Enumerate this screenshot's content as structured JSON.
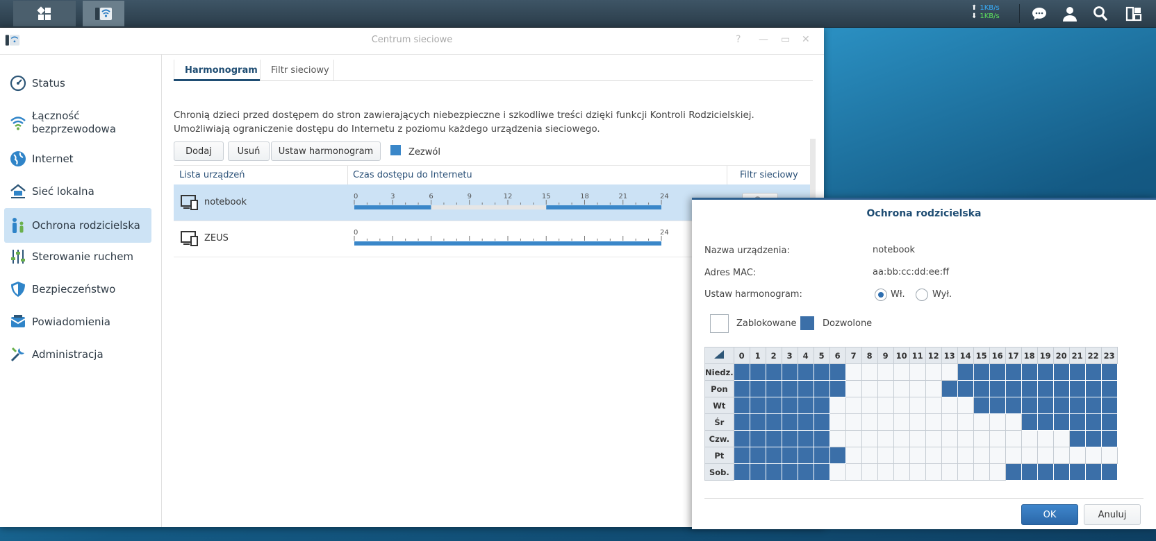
{
  "taskbar": {
    "speed_up": "1KB/s",
    "speed_down": "1KB/s",
    "icons": [
      "main-menu-icon",
      "network-center-app-icon",
      "chat-icon",
      "user-icon",
      "search-icon",
      "widgets-icon"
    ]
  },
  "window": {
    "title": "Centrum sieciowe",
    "controls": [
      "?",
      "—",
      "▭",
      "✕"
    ]
  },
  "sidebar": {
    "items": [
      {
        "label": "Status",
        "icon": "gauge-icon"
      },
      {
        "label": "Łączność\nbezprzewodowa",
        "icon": "wifi-icon"
      },
      {
        "label": "Internet",
        "icon": "globe-icon"
      },
      {
        "label": "Sieć lokalna",
        "icon": "home-network-icon"
      },
      {
        "label": "Ochrona rodzicielska",
        "icon": "parental-icon"
      },
      {
        "label": "Sterowanie ruchem",
        "icon": "sliders-icon"
      },
      {
        "label": "Bezpieczeństwo",
        "icon": "shield-icon"
      },
      {
        "label": "Powiadomienia",
        "icon": "notification-icon"
      },
      {
        "label": "Administracja",
        "icon": "tools-icon"
      }
    ],
    "active_index": 4
  },
  "tabs": [
    "Harmonogram",
    "Filtr sieciowy"
  ],
  "description": "Chronią dzieci przed dostępem do stron zawierających niebezpieczne i szkodliwe treści dzięki funkcji Kontroli Rodzicielskiej. Umożliwiają ograniczenie dostępu do Internetu z poziomu każdego urządzenia sieciowego.",
  "toolbar": {
    "add": "Dodaj",
    "remove": "Usuń",
    "schedule": "Ustaw harmonogram",
    "legend_allow": "Zezwól"
  },
  "table": {
    "headers": [
      "Lista urządzeń",
      "Czas dostępu do Internetu",
      "Filtr sieciowy"
    ],
    "rows": [
      {
        "device": "notebook",
        "ticks": [
          "0",
          "3",
          "6",
          "9",
          "12",
          "15",
          "18",
          "21",
          "24"
        ],
        "bar_segments": [
          [
            0,
            6
          ],
          [
            15,
            24
          ]
        ]
      },
      {
        "device": "ZEUS",
        "ticks": [
          "0",
          "24"
        ],
        "bar_segments": [
          [
            0,
            24
          ]
        ]
      }
    ]
  },
  "dialog": {
    "title": "Ochrona rodzicielska",
    "device_name_label": "Nazwa urządzenia:",
    "device_name": "notebook",
    "mac_label": "Adres MAC:",
    "mac": "aa:bb:cc:dd:ee:ff",
    "schedule_label": "Ustaw harmonogram:",
    "on": "Wł.",
    "off": "Wył.",
    "blocked": "Zablokowane",
    "allowed": "Dozwolone",
    "hours": [
      "0",
      "1",
      "2",
      "3",
      "4",
      "5",
      "6",
      "7",
      "8",
      "9",
      "10",
      "11",
      "12",
      "13",
      "14",
      "15",
      "16",
      "17",
      "18",
      "19",
      "20",
      "21",
      "22",
      "23"
    ],
    "days": [
      {
        "name": "Niedz.",
        "allowed": [
          0,
          1,
          2,
          3,
          4,
          5,
          6,
          14,
          15,
          16,
          17,
          18,
          19,
          20,
          21,
          22,
          23
        ]
      },
      {
        "name": "Pon",
        "allowed": [
          0,
          1,
          2,
          3,
          4,
          5,
          6,
          13,
          14,
          15,
          16,
          17,
          18,
          19,
          20,
          21,
          22,
          23
        ]
      },
      {
        "name": "Wt",
        "allowed": [
          0,
          1,
          2,
          3,
          4,
          5,
          15,
          16,
          17,
          18,
          19,
          20,
          21,
          22,
          23
        ]
      },
      {
        "name": "Śr",
        "allowed": [
          0,
          1,
          2,
          3,
          4,
          5,
          18,
          19,
          20,
          21,
          22,
          23
        ]
      },
      {
        "name": "Czw.",
        "allowed": [
          0,
          1,
          2,
          3,
          4,
          5,
          21,
          22,
          23
        ]
      },
      {
        "name": "Pt",
        "allowed": [
          0,
          1,
          2,
          3,
          4,
          5,
          6
        ]
      },
      {
        "name": "Sob.",
        "allowed": [
          0,
          1,
          2,
          3,
          4,
          5,
          17,
          18,
          19,
          20,
          21,
          22,
          23
        ]
      }
    ],
    "ok": "OK",
    "cancel": "Anuluj"
  }
}
